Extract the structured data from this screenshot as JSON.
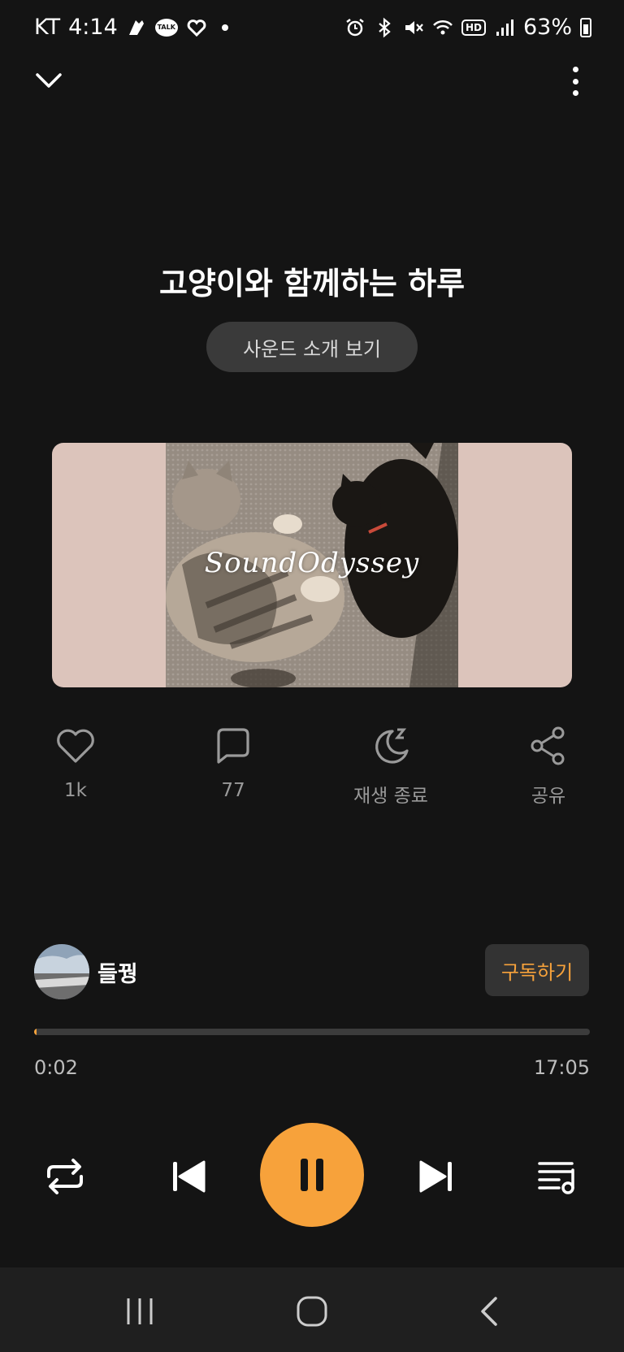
{
  "status": {
    "carrier": "KT",
    "time": "4:14",
    "talk": "TALK",
    "hd": "HD",
    "battery": "63%"
  },
  "icons": {
    "collapse": "chevron-down-icon",
    "more": "more-vertical-icon",
    "like": "heart-icon",
    "comment": "comment-icon",
    "sleep_timer": "moon-sleep-icon",
    "share": "share-icon",
    "repeat": "repeat-icon",
    "prev": "skip-previous-icon",
    "pause": "pause-icon",
    "next": "skip-next-icon",
    "queue": "playlist-icon"
  },
  "title": "고양이와 함께하는 하루",
  "intro_button": "사운드 소개 보기",
  "artwork": {
    "overlay_text": "SoundOdyssey",
    "side_color": "#dcc4bb"
  },
  "actions": {
    "like_label": "1k",
    "comment_label": "77",
    "sleep_label": "재생 종료",
    "share_label": "공유"
  },
  "channel": {
    "name": "들꿩",
    "subscribe_label": "구독하기"
  },
  "progress": {
    "fraction": 0.002,
    "current": "0:02",
    "total": "17:05"
  },
  "colors": {
    "accent": "#f7a23b",
    "background": "#141414"
  }
}
